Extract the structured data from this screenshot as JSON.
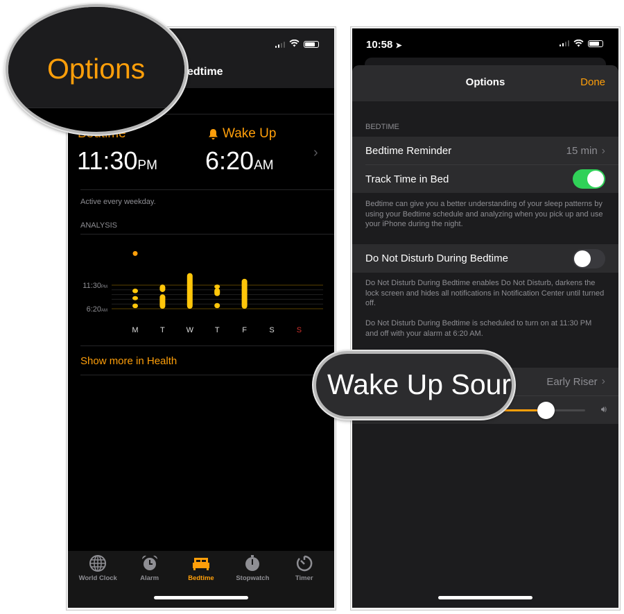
{
  "left_phone": {
    "nav_title": "Bedtime",
    "bedtime_label": "Bedtime",
    "bedtime_time": "11:30",
    "bedtime_ampm": "PM",
    "wakeup_label": "Wake Up",
    "wakeup_time": "6:20",
    "wakeup_ampm": "AM",
    "schedule_note": "Active every weekday.",
    "analysis_header": "ANALYSIS",
    "show_more_link": "Show more in Health",
    "tabs": [
      {
        "label": "World Clock",
        "icon": "globe-icon"
      },
      {
        "label": "Alarm",
        "icon": "alarm-clock-icon"
      },
      {
        "label": "Bedtime",
        "icon": "bed-icon",
        "active": true
      },
      {
        "label": "Stopwatch",
        "icon": "stopwatch-icon"
      },
      {
        "label": "Timer",
        "icon": "timer-icon"
      }
    ]
  },
  "analysis_chart": {
    "y_ticks": [
      {
        "time": "11:30",
        "ampm": "PM"
      },
      {
        "time": "6:20",
        "ampm": "AM"
      }
    ],
    "days": [
      "M",
      "T",
      "W",
      "T",
      "F",
      "S",
      "S"
    ],
    "weekend_color": "#d0312d",
    "sleep_segments": [
      [
        [
          "14:20",
          "14:20"
        ],
        [
          "00:30",
          "01:50"
        ],
        [
          "02:40",
          "03:40"
        ],
        [
          "04:50",
          "06:10"
        ]
      ],
      [
        [
          "23:20",
          "01:30"
        ],
        [
          "02:10",
          "06:20"
        ]
      ],
      [
        [
          "20:00",
          "06:20"
        ]
      ],
      [
        [
          "23:20",
          "23:40"
        ],
        [
          "00:20",
          "02:40"
        ],
        [
          "04:40",
          "06:10"
        ]
      ],
      [
        [
          "21:40",
          "06:20"
        ]
      ],
      [],
      []
    ]
  },
  "magnifier_left": {
    "text": "Options"
  },
  "right_phone": {
    "status_time": "10:58",
    "sheet_title": "Options",
    "done_button": "Done",
    "section_header": "BEDTIME",
    "bedtime_reminder_label": "Bedtime Reminder",
    "bedtime_reminder_value": "15 min",
    "track_time_label": "Track Time in Bed",
    "track_time_on": true,
    "track_time_footer": "Bedtime can give you a better understanding of your sleep patterns by using your Bedtime schedule and analyzing when you pick up and use your iPhone during the night.",
    "dnd_label": "Do Not Disturb During Bedtime",
    "dnd_on": false,
    "dnd_footer_1": "Do Not Disturb During Bedtime enables Do Not Disturb, darkens the lock screen and hides all notifications in Notification Center until turned off.",
    "dnd_footer_2": "Do Not Disturb During Bedtime is scheduled to turn on at 11:30 PM and off with your alarm at 6:20 AM.",
    "wake_sound_value": "Early Riser",
    "volume_percent": 82
  },
  "magnifier_right": {
    "text": "Wake Up Sour"
  },
  "colors": {
    "accent": "#ff9f0a",
    "toggle_on": "#30d158",
    "chart_dot": "#ffc60a"
  }
}
